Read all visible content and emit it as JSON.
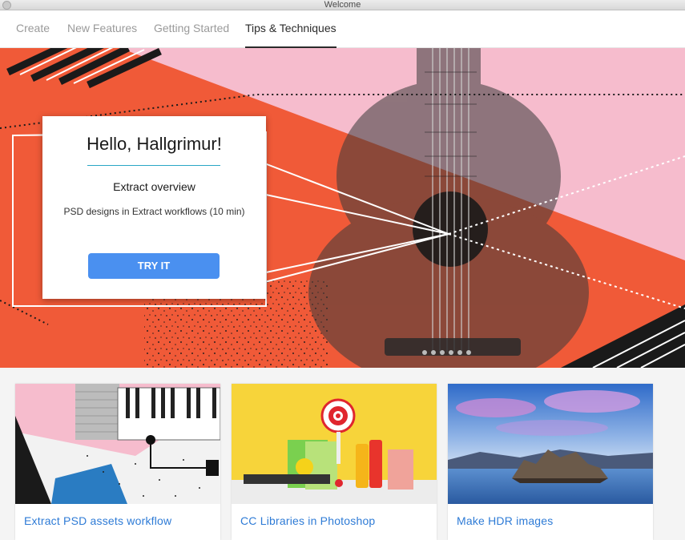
{
  "window": {
    "title": "Welcome"
  },
  "tabs": [
    {
      "label": "Create",
      "active": false
    },
    {
      "label": "New Features",
      "active": false
    },
    {
      "label": "Getting Started",
      "active": false
    },
    {
      "label": "Tips & Techniques",
      "active": true
    }
  ],
  "hero": {
    "greeting": "Hello, Hallgrimur!",
    "card_title": "Extract overview",
    "card_description": "PSD designs in Extract workflows (10 min)",
    "cta_label": "TRY IT",
    "colors": {
      "orange": "#f05a38",
      "pink": "#f6bccd",
      "accent_line": "#2aa6c6",
      "button": "#4a90f0"
    }
  },
  "tiles": [
    {
      "label": "Extract PSD assets workflow"
    },
    {
      "label": "CC Libraries in Photoshop"
    },
    {
      "label": "Make HDR images"
    }
  ]
}
